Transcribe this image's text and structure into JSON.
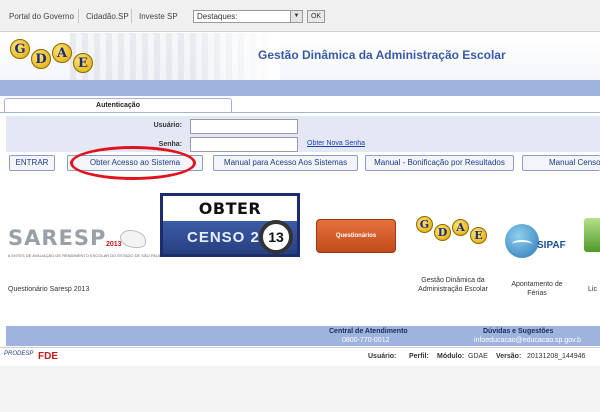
{
  "govbar": {
    "links": [
      "Portal do Governo",
      "Cidadão.SP",
      "Investe SP"
    ],
    "select_value": "Destaques:",
    "ok_label": "OK"
  },
  "header": {
    "logo_letters": [
      "G",
      "D",
      "A",
      "E"
    ],
    "title": "Gestão Dinâmica da Administração Escolar"
  },
  "auth": {
    "tab_label": "Autenticação",
    "user_label": "Usuário:",
    "password_label": "Senha:",
    "new_password_link": "Obter Nova Senha"
  },
  "buttons": {
    "enter": "ENTRAR",
    "access": "Obter Acesso ao Sistema",
    "manual_access": "Manual para Acesso Aos Sistemas",
    "manual_bonus": "Manual - Bonificação por Resultados",
    "manual_censo": "Manual Censo"
  },
  "panels": {
    "saresp_word": "SARESP",
    "saresp_year": "2013",
    "saresp_sub": "6 ENTES DE AVALIAÇÃO DE RENDIMENTO ESCOLAR DO ESTADO DE SÃO PAULO",
    "saresp_caption": "Questionário Saresp 2013",
    "censo_top": "OBTER ACESSO",
    "censo_bottom": "CENSO 20",
    "censo_num": "13",
    "quest_label": "Questionários",
    "gdae_caption": "Gestão Dinâmica da Administração Escolar",
    "sipaf_word": "SIPAF",
    "sipaf_caption": "Apontamento de Férias",
    "partial_caption": "Lic"
  },
  "footer": {
    "central_label": "Central de Atendimento",
    "central_value": "0800-770-0012",
    "duvidas_label": "Dúvidas e Sugestões",
    "duvidas_value": "infoeducacao@educacao.sp.gov.b",
    "prodesp": "PRODESP",
    "fde": "FDE",
    "usuario_label": "Usuário:",
    "perfil_label": "Perfil:",
    "modulo_label": "Módulo:",
    "modulo_value": "GDAE",
    "versao_label": "Versão:",
    "versao_value": "20131208_144946"
  },
  "colors": {
    "nav_blue": "#9fb3df",
    "title_blue": "#3a5aa8",
    "highlight_red": "#e0141e",
    "quest_orange": "#d45a25"
  }
}
